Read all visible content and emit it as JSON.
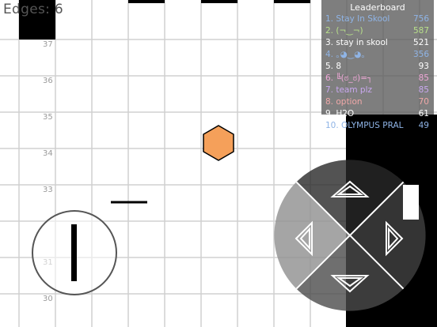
{
  "hud": {
    "edges_label": "Edges: 6"
  },
  "grid": {
    "row_labels": [
      "37",
      "36",
      "35",
      "34",
      "33",
      "31",
      "30"
    ]
  },
  "leaderboard": {
    "title": "Leaderboard",
    "entries": [
      {
        "name": "1. Stay In Skool",
        "score": "756",
        "color": "#8fb4e6"
      },
      {
        "name": "2. (¬‿¬)",
        "score": "587",
        "color": "#b8e08a"
      },
      {
        "name": "3. stay in skool",
        "score": "521",
        "color": "#ffffff"
      },
      {
        "name": "4. ｡◕‿◕｡",
        "score": "356",
        "color": "#8fb4e6"
      },
      {
        "name": "5. 8",
        "score": "93",
        "color": "#ffffff"
      },
      {
        "name": "6. ╚(ಠ_ಠ)=┐",
        "score": "85",
        "color": "#f0a8d8"
      },
      {
        "name": "7. team plz",
        "score": "85",
        "color": "#c9a8f0"
      },
      {
        "name": "8. option",
        "score": "70",
        "color": "#f0a8a8"
      },
      {
        "name": "9. H2O",
        "score": "61",
        "color": "#ffffff"
      },
      {
        "name": "10. OLYMPUS PRAL",
        "score": "49",
        "color": "#8fb4e6"
      }
    ]
  },
  "colors": {
    "filled_cell": "#000000",
    "grid_line": "#d0d0d0",
    "player_hexagon": "#f5a05a",
    "player_outline": "#000000"
  },
  "icons": {
    "joystick": "joystick-icon",
    "dpad_up": "arrow-up-icon",
    "dpad_down": "arrow-down-icon",
    "dpad_left": "arrow-left-icon",
    "dpad_right": "arrow-right-icon"
  }
}
